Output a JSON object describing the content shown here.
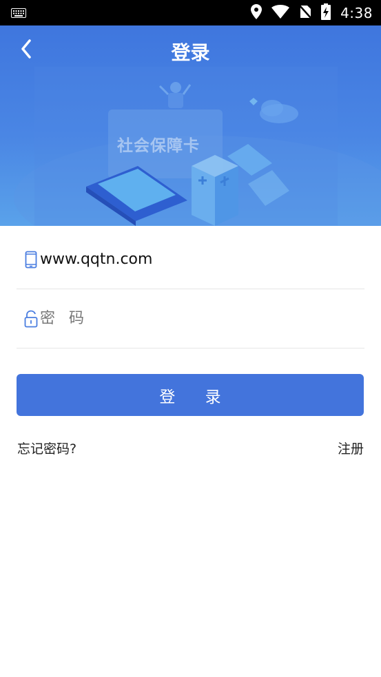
{
  "status_bar": {
    "time": "4:38",
    "icons": [
      "keyboard-icon",
      "location-icon",
      "wifi-icon",
      "no-sim-icon",
      "battery-charging-icon"
    ]
  },
  "header": {
    "title": "登录",
    "back_icon": "chevron-left-icon",
    "banner_card_text": "社会保障卡"
  },
  "form": {
    "account": {
      "value": "www.qqtn.com",
      "icon": "phone-icon"
    },
    "password": {
      "placeholder": "密码",
      "icon": "lock-icon"
    },
    "login_button": "登 录"
  },
  "links": {
    "forgot_password": "忘记密码?",
    "register": "注册"
  },
  "colors": {
    "primary": "#4374dc",
    "banner_top": "#3f76de",
    "banner_bottom": "#5aa2ea",
    "icon_blue": "#4a7de0"
  }
}
